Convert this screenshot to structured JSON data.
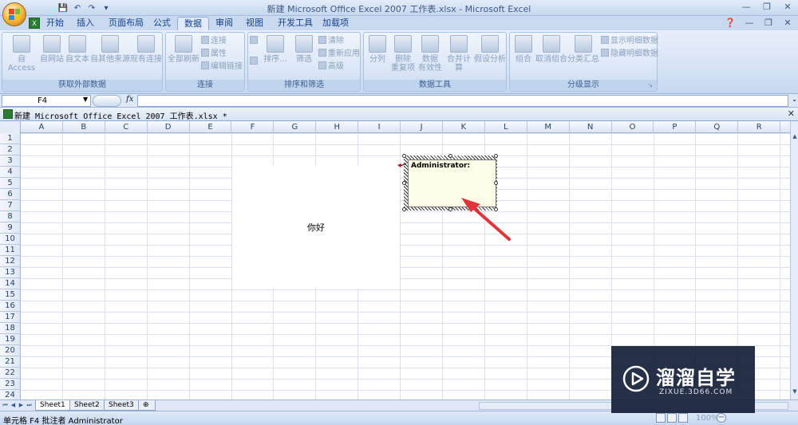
{
  "window": {
    "title": "新建 Microsoft Office Excel 2007 工作表.xlsx - Microsoft Excel"
  },
  "qat": {
    "dropdown_glyph": "▾"
  },
  "tabs": [
    {
      "label": "开始"
    },
    {
      "label": "插入"
    },
    {
      "label": "页面布局"
    },
    {
      "label": "公式"
    },
    {
      "label": "数据",
      "active": true
    },
    {
      "label": "审阅"
    },
    {
      "label": "视图"
    },
    {
      "label": "开发工具"
    },
    {
      "label": "加载项"
    }
  ],
  "ribbon": {
    "groups": [
      {
        "label": "获取外部数据",
        "items": [
          "自 Access",
          "自网站",
          "自文本",
          "自其他来源",
          "现有连接"
        ]
      },
      {
        "label": "连接",
        "big": "全部刷新",
        "small": [
          "连接",
          "属性",
          "编辑链接"
        ]
      },
      {
        "label": "排序和筛选",
        "big": [
          "排序...",
          "筛选"
        ],
        "small": [
          "清除",
          "重新应用",
          "高级"
        ]
      },
      {
        "label": "数据工具",
        "items": [
          "分列",
          "删除\n重复项",
          "数据\n有效性",
          "合并计算",
          "假设分析"
        ]
      },
      {
        "label": "分级显示",
        "items": [
          "组合",
          "取消组合",
          "分类汇总"
        ],
        "small": [
          "显示明细数据",
          "隐藏明细数据"
        ]
      }
    ]
  },
  "formula_bar": {
    "name_box": "F4",
    "fx_label": "fx",
    "value": ""
  },
  "workbook": {
    "title": "新建 Microsoft Office Excel 2007 工作表.xlsx *"
  },
  "grid": {
    "columns": [
      "A",
      "B",
      "C",
      "D",
      "E",
      "F",
      "G",
      "H",
      "I",
      "J",
      "K",
      "L",
      "M",
      "N",
      "O",
      "P",
      "Q",
      "R"
    ],
    "rows": [
      "1",
      "2",
      "3",
      "4",
      "5",
      "6",
      "7",
      "8",
      "9",
      "10",
      "11",
      "12",
      "13",
      "14",
      "15",
      "16",
      "17",
      "18",
      "19",
      "20",
      "21",
      "22",
      "23",
      "24"
    ],
    "merged_cell_text": "你好"
  },
  "comment": {
    "author": "Administrator:",
    "body": ""
  },
  "sheets": [
    {
      "name": "Sheet1",
      "active": true
    },
    {
      "name": "Sheet2"
    },
    {
      "name": "Sheet3"
    }
  ],
  "status": {
    "text": "单元格 F4 批注者 Administrator",
    "zoom": "100%"
  },
  "watermark": {
    "name": "溜溜自学",
    "url": "ZIXUE.3D66.COM"
  },
  "colors": {
    "accent": "#15428b",
    "annotation_arrow": "#e0343a",
    "comment_bg": "#fbfbe6"
  }
}
